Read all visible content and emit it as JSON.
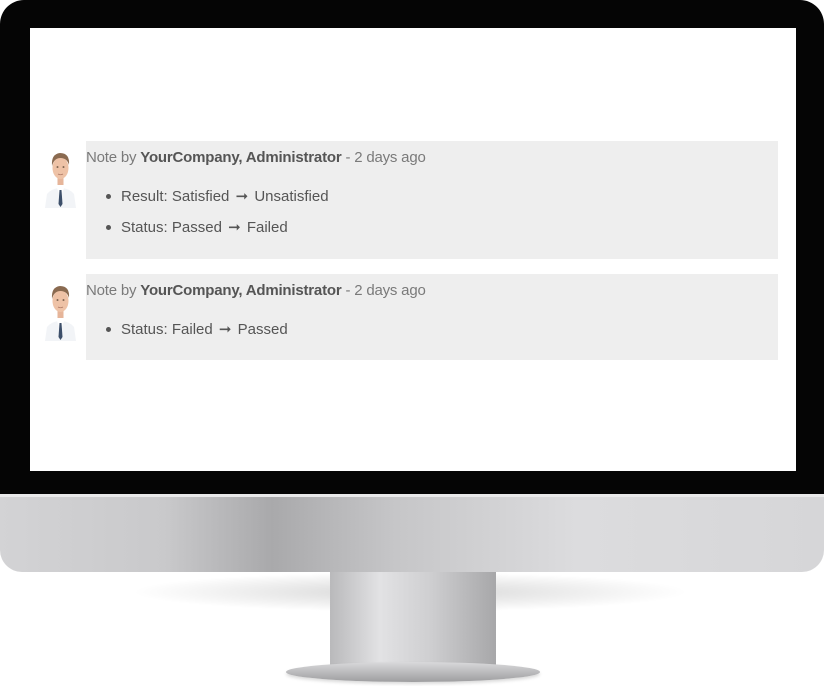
{
  "notes": [
    {
      "prefix": "Note by",
      "author": "YourCompany, Administrator",
      "time": "- 2 days ago",
      "changes": [
        {
          "field": "Result:",
          "from": "Satisfied",
          "arrow": "➞",
          "to": "Unsatisfied"
        },
        {
          "field": "Status:",
          "from": "Passed",
          "arrow": "➞",
          "to": "Failed"
        }
      ]
    },
    {
      "prefix": "Note by",
      "author": "YourCompany, Administrator",
      "time": "- 2 days ago",
      "changes": [
        {
          "field": "Status:",
          "from": "Failed",
          "arrow": "➞",
          "to": "Passed"
        }
      ]
    }
  ],
  "icons": {
    "avatar": "user-avatar-icon",
    "change_arrow": "right-arrow-icon"
  },
  "colors": {
    "card_background": "#eeeeee",
    "text": "#555555",
    "meta_text": "#7a7a7a",
    "bezel": "#050505"
  }
}
